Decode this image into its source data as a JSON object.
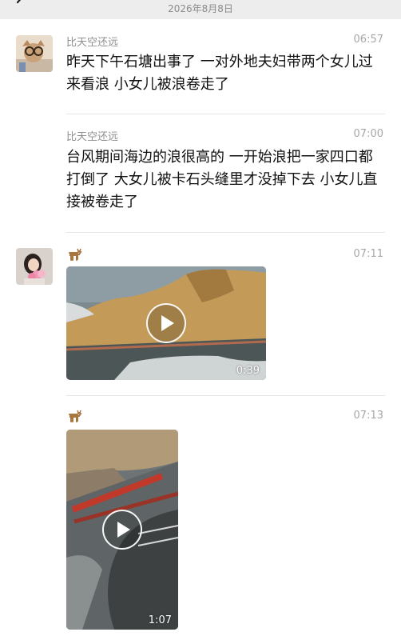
{
  "header": {
    "date": "2026年8月8日"
  },
  "messages": [
    {
      "sender": "比天空还远",
      "time": "06:57",
      "text": "昨天下午石塘出事了 一对外地夫妇带两个女儿过来看浪 小女儿被浪卷走了"
    },
    {
      "sender": "比天空还远",
      "time": "07:00",
      "text": "台风期间海边的浪很高的 一开始浪把一家四口都打倒了 大女儿被卡石头缝里才没掉下去 小女儿直接被卷走了"
    },
    {
      "sender_icon": "deer-icon",
      "time": "07:11",
      "video_duration": "0:39"
    },
    {
      "sender_icon": "deer-icon",
      "time": "07:13",
      "video_duration": "1:07"
    }
  ]
}
